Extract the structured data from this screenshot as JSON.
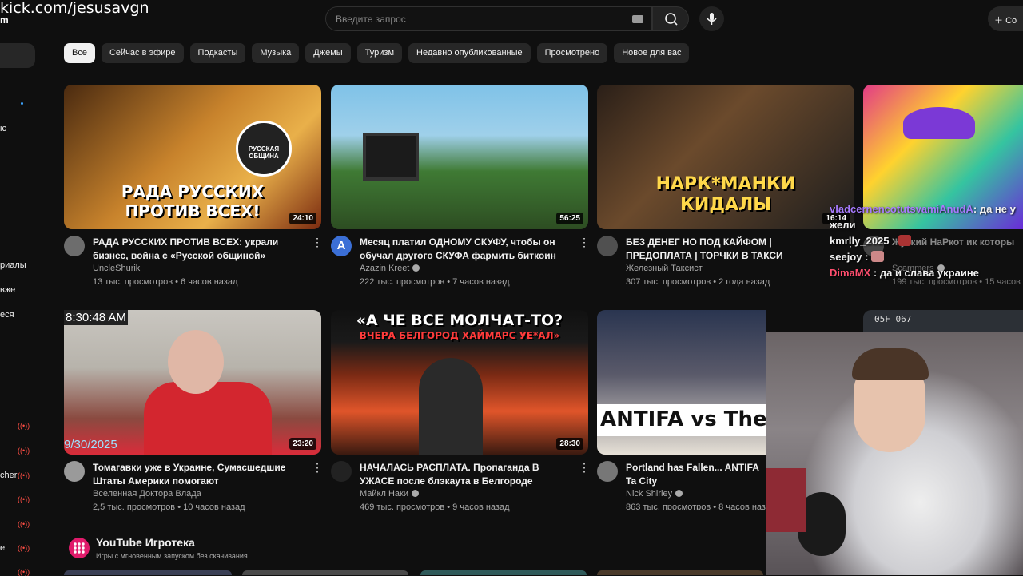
{
  "overlay": {
    "stream_url": "kick.com/jesusavgn",
    "stream_url_suffix": "m"
  },
  "sidebar": {
    "labels": [
      "ic",
      "риалы",
      "вже",
      "еся",
      "cher",
      "e"
    ]
  },
  "header": {
    "search_placeholder": "Введите запрос",
    "create_label": "Со"
  },
  "chips": [
    "Все",
    "Сейчас в эфире",
    "Подкасты",
    "Музыка",
    "Джемы",
    "Туризм",
    "Недавно опубликованные",
    "Просмотрено",
    "Новое для вас"
  ],
  "videos": [
    {
      "thumb_text": "РАДА РУССКИХ ПРОТИВ ВСЕХ!",
      "badge": "РУССКАЯ ОБЩИНА",
      "duration": "24:10",
      "title": "РАДА РУССКИХ ПРОТИВ ВСЕХ: украли бизнес, война с «Русской общиной»",
      "channel": "UncleShurik",
      "stats": "13 тыс. просмотров • 6 часов назад"
    },
    {
      "thumb_text": "",
      "duration": "56:25",
      "title": "Месяц платил ОДНОМУ СКУФУ, чтобы он обучал другого СКУФА фармить биткоин на ...",
      "channel": "Azazin Kreet",
      "stats": "222 тыс. просмотров • 7 часов назад",
      "avatar_letter": "A"
    },
    {
      "thumb_text": "НАРК*МАНКИ КИДАЛЫ",
      "duration": "16:14",
      "title": "БЕЗ ДЕНЕГ НО ПОД КАЙФОМ | ПРЕДОПЛАТА | ТОРЧКИ В ТАКСИ",
      "channel": "Железный Таксист",
      "stats": "307 тыс. просмотров • 2 года назад"
    },
    {
      "thumb_text": "",
      "duration": "",
      "title": "Жуткий НаРкот ик которы",
      "channel": "Scammers",
      "stats": "199 тыс. просмотров • 15 часов на"
    },
    {
      "thumb_text": "",
      "clock": "8:30:48 AM",
      "date": "9/30/2025",
      "duration": "23:20",
      "title": "Томагавки уже в Украине, Сумасшедшие Штаты Америки помогают",
      "channel": "Вселенная Доктора Влада",
      "stats": "2,5 тыс. просмотров • 10 часов назад"
    },
    {
      "thumb_text": "«А ЧЕ ВСЕ МОЛЧАТ-ТО?",
      "thumb_sub": "ВЧЕРА БЕЛГОРОД ХАЙМАРС УЕ*АЛ»",
      "duration": "28:30",
      "title": "НАЧАЛАСЬ РАСПЛАТА. Пропаганда В УЖАСЕ после блэкаута в Белгороде",
      "channel": "Майкл Наки",
      "stats": "469 тыс. просмотров • 9 часов назад"
    },
    {
      "thumb_text": "ANTIFA vs The",
      "duration": "",
      "title": "Portland has Fallen... ANTIFA Ta City",
      "channel": "Nick Shirley",
      "stats": "863 тыс. просмотров • 8 часов назад"
    },
    {
      "thumb_text": "05F 067",
      "duration": "",
      "title": "",
      "channel": "",
      "stats": ""
    }
  ],
  "arcade": {
    "title": "YouTube Игротека",
    "subtitle": "Игры с мгновенным запуском без скачивания"
  },
  "chat": [
    {
      "user": "vladcernencotutsvamiAnudA",
      "color": "#a77bff",
      "text": ": да не у жели"
    },
    {
      "user": "kmrlly_2025",
      "color": "#f1f1f1",
      "text": " :"
    },
    {
      "user": "seejoy",
      "color": "#f1f1f1",
      "text": " :"
    },
    {
      "user": "DimaMX",
      "color": "#ff4e6e",
      "text": " : да и слава украине"
    }
  ],
  "colors": {
    "bg": "#0f0f0f",
    "chip": "#272727",
    "accent_live": "#ff4e45"
  }
}
